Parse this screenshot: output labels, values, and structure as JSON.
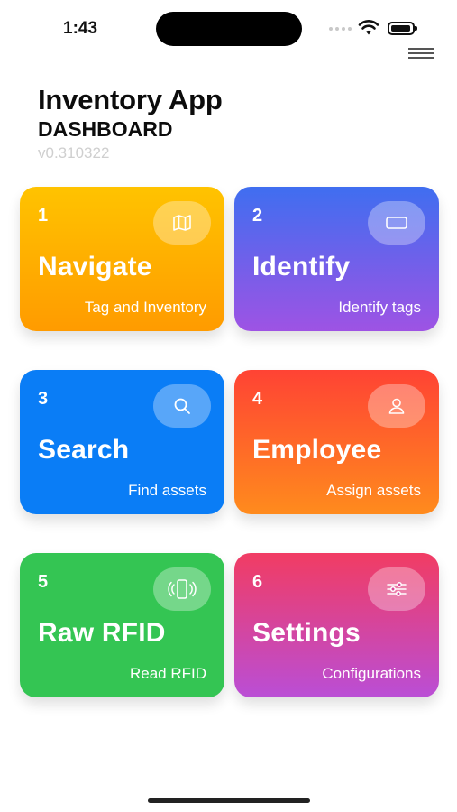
{
  "status_bar": {
    "time": "1:43"
  },
  "header": {
    "title": "Inventory App",
    "subtitle": "DASHBOARD",
    "version": "v0.310322"
  },
  "cards": [
    {
      "number": "1",
      "title": "Navigate",
      "subtitle": "Tag and Inventory",
      "icon": "map-icon"
    },
    {
      "number": "2",
      "title": "Identify",
      "subtitle": "Identify tags",
      "icon": "tag-icon"
    },
    {
      "number": "3",
      "title": "Search",
      "subtitle": "Find assets",
      "icon": "search-icon"
    },
    {
      "number": "4",
      "title": "Employee",
      "subtitle": "Assign assets",
      "icon": "person-icon"
    },
    {
      "number": "5",
      "title": "Raw RFID",
      "subtitle": "Read RFID",
      "icon": "rfid-phone-icon"
    },
    {
      "number": "6",
      "title": "Settings",
      "subtitle": "Configurations",
      "icon": "sliders-icon"
    }
  ],
  "colors": {
    "navigate": "#ffb300",
    "identify": "#6a63ea",
    "search": "#0a7df6",
    "employee": "#ff6228",
    "raw_rfid": "#34c553",
    "settings": "#d9459b"
  }
}
